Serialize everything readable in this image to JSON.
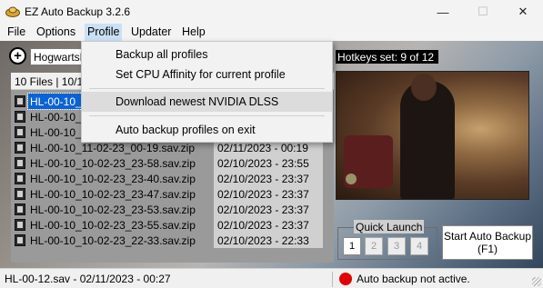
{
  "window": {
    "title": "EZ Auto Backup 3.2.6",
    "minimize_glyph": "—",
    "maximize_glyph": "☐",
    "close_glyph": "✕"
  },
  "menu": {
    "file": "File",
    "options": "Options",
    "profile": "Profile",
    "updater": "Updater",
    "help": "Help"
  },
  "profile_menu": {
    "items": [
      "Backup all profiles",
      "Set CPU Affinity for current profile",
      "Download newest NVIDIA DLSS",
      "Auto backup profiles on exit"
    ],
    "hovered_index": 2
  },
  "profile_bar": {
    "add_glyph": "+",
    "selected_profile": "HogwartsL"
  },
  "files": {
    "header": "10 Files | 10/10",
    "rows": [
      {
        "name": "HL-00-10_1",
        "date": ""
      },
      {
        "name": "HL-00-10_1",
        "date": ""
      },
      {
        "name": "HL-00-10_1",
        "date": ""
      },
      {
        "name": "HL-00-10_11-02-23_00-19.sav.zip",
        "date": "02/11/2023 - 00:19"
      },
      {
        "name": "HL-00-10_10-02-23_23-58.sav.zip",
        "date": "02/10/2023 - 23:55"
      },
      {
        "name": "HL-00-10_10-02-23_23-40.sav.zip",
        "date": "02/10/2023 - 23:37"
      },
      {
        "name": "HL-00-10_10-02-23_23-47.sav.zip",
        "date": "02/10/2023 - 23:37"
      },
      {
        "name": "HL-00-10_10-02-23_23-53.sav.zip",
        "date": "02/10/2023 - 23:37"
      },
      {
        "name": "HL-00-10_10-02-23_23-55.sav.zip",
        "date": "02/10/2023 - 23:37"
      },
      {
        "name": "HL-00-10_10-02-23_22-33.sav.zip",
        "date": "02/10/2023 - 22:33"
      }
    ],
    "selected_index": 0
  },
  "hotkeys": {
    "label": "Hotkeys set: 9 of 12"
  },
  "quick_launch": {
    "title": "Quick Launch",
    "buttons": [
      "1",
      "2",
      "3",
      "4"
    ],
    "active_index": 0
  },
  "auto_backup_button": {
    "line1": "Start Auto Backup",
    "line2": "(F1)"
  },
  "status": {
    "left": "HL-00-12.sav - 02/11/2023 - 00:27",
    "right": "Auto backup not active.",
    "indicator_color": "#e00000"
  }
}
